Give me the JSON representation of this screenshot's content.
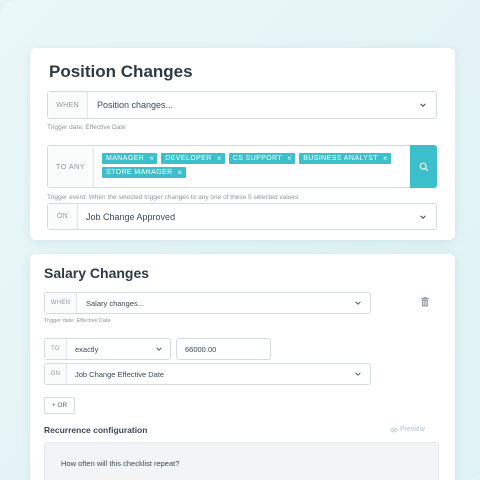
{
  "position_card": {
    "title": "Position Changes",
    "when_prefix": "WHEN",
    "when_value": "Position changes...",
    "trigger_hint": "Trigger date: Effective Date",
    "to_any_prefix": "TO ANY",
    "tags": [
      "MANAGER",
      "DEVELOPER",
      "CS SUPPORT",
      "BUSINESS ANALYST",
      "STORE MANAGER"
    ],
    "tag_remove_glyph": "×",
    "event_hint": "Trigger event: When the selected trigger changes to any one of these 5 selected values",
    "on_prefix": "ON",
    "on_value": "Job Change Approved"
  },
  "salary_card": {
    "title": "Salary Changes",
    "when_prefix": "WHEN",
    "when_value": "Salary changes...",
    "trigger_hint": "Trigger date: Effective Date",
    "to_prefix": "TO",
    "to_value": "exactly",
    "amount_value": "66000.00",
    "on_prefix": "ON",
    "on_value": "Job Change Effective Date",
    "or_button": "+ OR",
    "recurrence_label": "Recurrence configuration",
    "preview_label": "Preview",
    "recurrence_question": "How often will this checklist repeat?"
  },
  "colors": {
    "accent": "#3bbfca",
    "background": "#e3f4f6",
    "card": "#ffffff"
  },
  "icons": [
    "chevron-down-icon",
    "close-icon",
    "search-icon",
    "trash-icon",
    "eye-icon"
  ]
}
